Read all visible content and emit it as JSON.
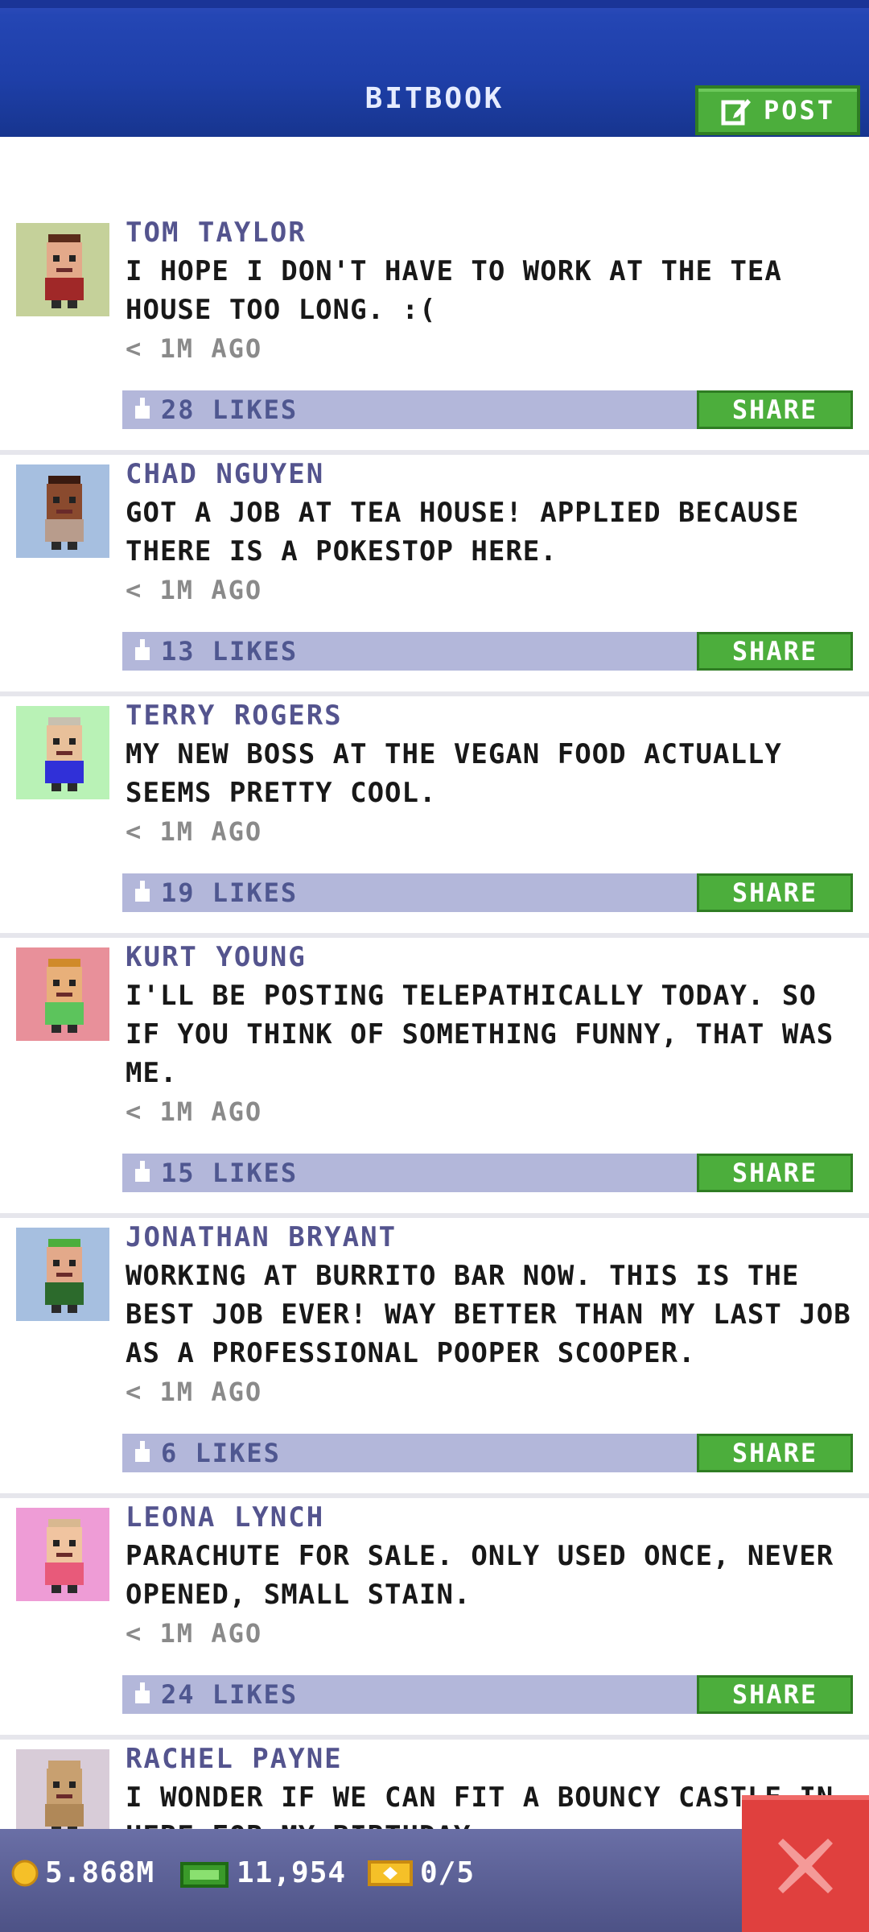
{
  "header": {
    "title": "BITBOOK",
    "post_label": "POST"
  },
  "posts": [
    {
      "name": "TOM TAYLOR",
      "text": "I HOPE I DON'T HAVE TO WORK AT THE TEA HOUSE TOO LONG. :(",
      "time": "< 1M AGO",
      "likes": "28 LIKES",
      "share": "SHARE",
      "avatar_bg": "#c5d19a",
      "avatar_skin": "#e3a98a",
      "avatar_shirt": "#a02828",
      "avatar_hair": "#5a2b1a"
    },
    {
      "name": "CHAD NGUYEN",
      "text": "GOT A JOB AT TEA HOUSE! APPLIED BECAUSE THERE IS A POKESTOP HERE.",
      "time": "< 1M AGO",
      "likes": "13 LIKES",
      "share": "SHARE",
      "avatar_bg": "#a6bfe0",
      "avatar_skin": "#8a4a2e",
      "avatar_shirt": "#b89c8c",
      "avatar_hair": "#3a1a10"
    },
    {
      "name": "TERRY ROGERS",
      "text": "MY NEW BOSS AT THE VEGAN FOOD ACTUALLY SEEMS PRETTY COOL.",
      "time": "< 1M AGO",
      "likes": "19 LIKES",
      "share": "SHARE",
      "avatar_bg": "#b9f2b6",
      "avatar_skin": "#e8c09a",
      "avatar_shirt": "#3030d8",
      "avatar_hair": "#c8c0b0"
    },
    {
      "name": "KURT YOUNG",
      "text": "I'LL BE POSTING TELEPATHICALLY TODAY. SO IF YOU THINK OF SOMETHING FUNNY, THAT WAS ME.",
      "time": "< 1M AGO",
      "likes": "15 LIKES",
      "share": "SHARE",
      "avatar_bg": "#e8909a",
      "avatar_skin": "#e8b07a",
      "avatar_shirt": "#5cc45c",
      "avatar_hair": "#d08a2a"
    },
    {
      "name": "JONATHAN BRYANT",
      "text": "WORKING AT BURRITO BAR NOW. THIS IS THE BEST JOB EVER! WAY BETTER THAN MY LAST JOB AS A PROFESSIONAL POOPER SCOOPER.",
      "time": "< 1M AGO",
      "likes": "6 LIKES",
      "share": "SHARE",
      "avatar_bg": "#a6bfe0",
      "avatar_skin": "#e3a98a",
      "avatar_shirt": "#2c6a2c",
      "avatar_hair": "#4cae3c"
    },
    {
      "name": "LEONA LYNCH",
      "text": "PARACHUTE FOR SALE. ONLY USED ONCE, NEVER OPENED, SMALL STAIN.",
      "time": "< 1M AGO",
      "likes": "24 LIKES",
      "share": "SHARE",
      "avatar_bg": "#ee9cd6",
      "avatar_skin": "#f0c4a0",
      "avatar_shirt": "#e85a7a",
      "avatar_hair": "#d8b890"
    },
    {
      "name": "RACHEL PAYNE",
      "text": "I WONDER IF WE CAN FIT A BOUNCY CASTLE IN HERE FOR MY BIRTHDAY...",
      "time": "",
      "likes": "",
      "share": "",
      "avatar_bg": "#d8ccd8",
      "avatar_skin": "#c8a070",
      "avatar_shirt": "#b08858",
      "avatar_hair": "#c8a070"
    }
  ],
  "bottom": {
    "coins": "5.868M",
    "bux": "11,954",
    "tickets": "0/5"
  },
  "colors": {
    "header_blue": "#1e3fa8",
    "share_green": "#4cae3c",
    "like_bar": "#b3b7da",
    "close_red": "#e0403e"
  }
}
